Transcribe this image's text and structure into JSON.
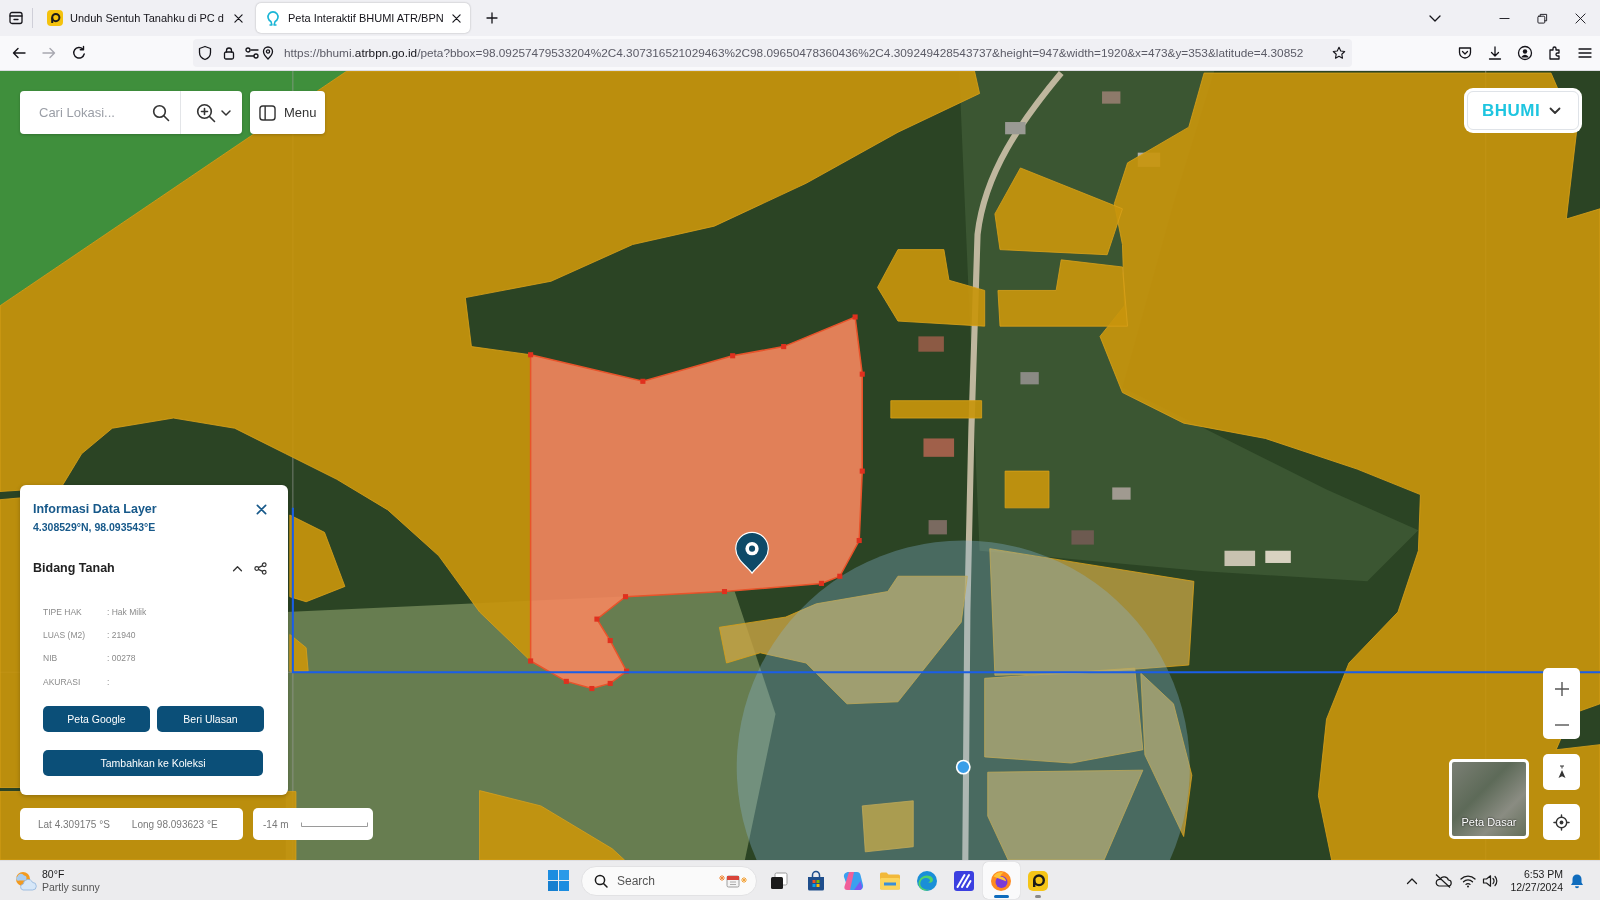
{
  "browser": {
    "tabs": [
      {
        "kind": "badge",
        "title": "Unduh Sentuh Tanahku di PC d",
        "selected": false
      },
      {
        "kind": "pin",
        "title": "Peta Interaktif BHUMI ATR/BPN",
        "selected": true
      }
    ],
    "url": {
      "start": "https://bhumi.",
      "domain": "atrbpn.go.id",
      "rest": "/peta?bbox=98.09257479533204%2C4.307316521029463%2C98.09650478360436%2C4.309249428543737&height=947&width=1920&x=473&y=353&latitude=4.30852"
    }
  },
  "map": {
    "search": {
      "placeholder": "Cari Lokasi..."
    },
    "menu_button": "Menu",
    "logo": "BHUMI",
    "info_panel": {
      "title": "Informasi Data Layer",
      "coordinates": "4.308529°N, 98.093543°E",
      "section": {
        "title": "Bidang Tanah",
        "expanded": true,
        "fields": [
          {
            "label": "TIPE HAK",
            "value": ": Hak Milik"
          },
          {
            "label": "LUAS (M2)",
            "value": ": 21940"
          },
          {
            "label": "NIB",
            "value": ": 00278"
          },
          {
            "label": "AKURASI",
            "value": ":"
          }
        ]
      },
      "buttons": [
        "Peta Google",
        "Beri Ulasan"
      ],
      "wide_button": "Tambahkan ke Koleksi"
    },
    "position": {
      "latitude": "Lat 4.309175 °S",
      "longitude": "Long 98.093623 °E"
    },
    "scale": "-14 m",
    "basemap": "Peta Dasar"
  },
  "taskbar": {
    "weather": {
      "temperature": "80°F",
      "condition": "Partly sunny"
    },
    "search": {
      "placeholder": "Search"
    },
    "apps": [
      {
        "kind": "taskview",
        "running": false,
        "selected": false
      },
      {
        "kind": "store",
        "running": false,
        "selected": false
      },
      {
        "kind": "assistant",
        "running": false,
        "selected": false
      },
      {
        "kind": "files",
        "running": false,
        "selected": false
      },
      {
        "kind": "edge",
        "running": false,
        "selected": false
      },
      {
        "kind": "editor",
        "running": false,
        "selected": false
      },
      {
        "kind": "firefox",
        "running": true,
        "selected": true
      },
      {
        "kind": "tile",
        "running": true,
        "selected": false
      }
    ],
    "clock": {
      "time": "6:53 PM",
      "date": "12/27/2024"
    }
  }
}
